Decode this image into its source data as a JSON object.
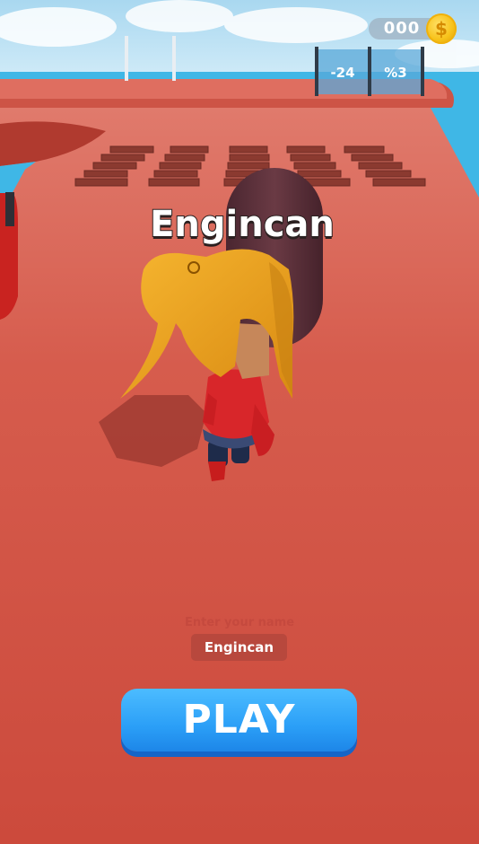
{
  "hud": {
    "coin_count": "000",
    "coin_icon": "dollar-coin-icon",
    "coin_glyph": "$"
  },
  "gates": {
    "left_label": "-24",
    "right_label": "%3",
    "panel_color": "#5aa8d8"
  },
  "player": {
    "name_tag": "Engincan",
    "hair_color": "#f0a825",
    "shirt_color": "#d8262a"
  },
  "name_entry": {
    "hint": "Enter your name",
    "value": "Engincan"
  },
  "play_button": {
    "label": "PLAY",
    "color": "#2b9ff7"
  },
  "colors": {
    "track": "#d4584a",
    "sky": "#bfe3f5",
    "water": "#3fb7e6"
  }
}
